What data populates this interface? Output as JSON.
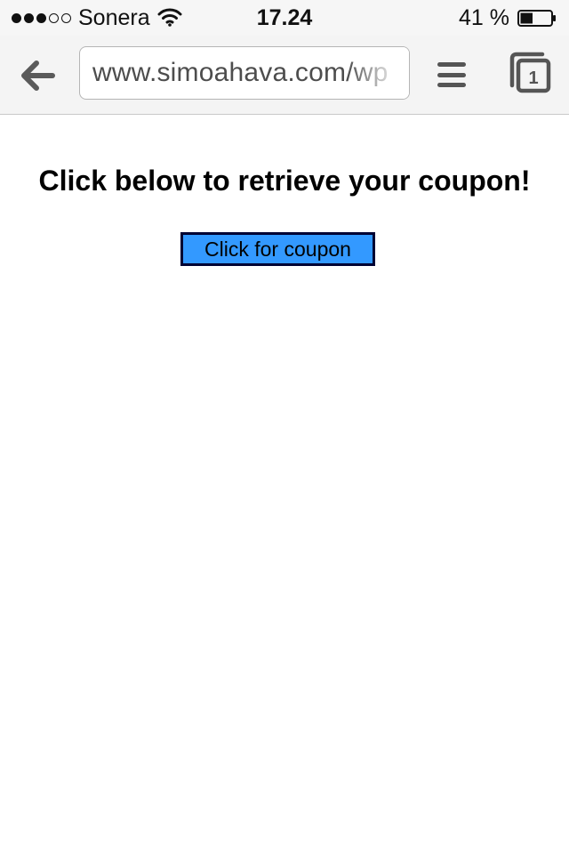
{
  "status_bar": {
    "signal_strength": 3,
    "signal_max": 5,
    "carrier": "Sonera",
    "time": "17.24",
    "battery_percent_text": "41 %",
    "battery_level": 0.41,
    "icons": [
      "signal-dots-icon",
      "wifi-icon",
      "battery-icon"
    ]
  },
  "browser": {
    "back_icon": "back-arrow-icon",
    "url": "www.simoahava.com/wp",
    "menu_icon": "hamburger-menu-icon",
    "tabs_icon": "tabs-icon",
    "tab_count": "1"
  },
  "page": {
    "heading": "Click below to retrieve your coupon!",
    "coupon_button_label": "Click for coupon",
    "colors": {
      "button_fill": "#3399ff",
      "button_border": "#000033",
      "heading_text": "#000000"
    }
  }
}
